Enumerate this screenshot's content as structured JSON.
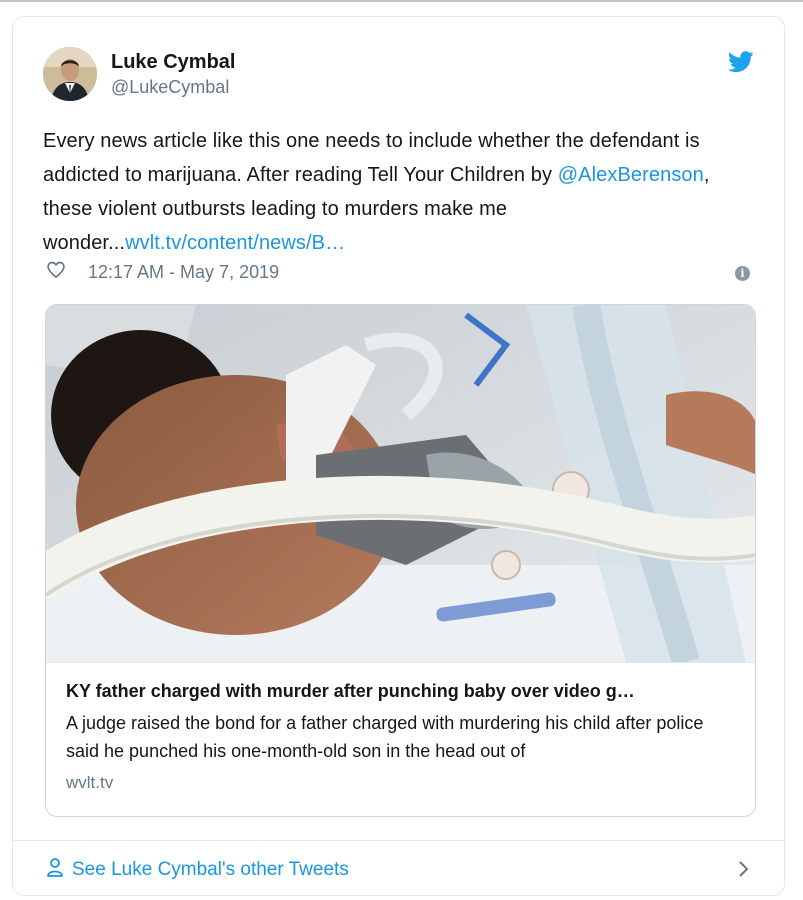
{
  "author": {
    "name": "Luke Cymbal",
    "handle": "@LukeCymbal"
  },
  "tweet": {
    "text_part1": "Every news article like this one needs to include whether the defendant is addicted to marijuana.  After reading Tell Your Children by ",
    "mention": "@AlexBerenson",
    "text_part2": ", these violent outbursts leading to murders make me wonder...",
    "url": "wvlt.tv/content/news/B…",
    "timestamp": "12:17 AM - May 7, 2019"
  },
  "link_card": {
    "title": "KY father charged with murder after punching baby over video g…",
    "description": "A judge raised the bond for a father charged with murdering his child after police said he punched his one-month-old son in the head out of",
    "domain": "wvlt.tv"
  },
  "footer": {
    "label": "See Luke Cymbal's other Tweets"
  },
  "icons": {
    "brand": "twitter-bird-icon",
    "like": "heart-icon",
    "info": "info-icon",
    "person": "person-icon",
    "chevron": "chevron-right-icon"
  },
  "colors": {
    "link": "#1b95e0",
    "muted": "#657786",
    "twitter_blue": "#1da1f2"
  }
}
